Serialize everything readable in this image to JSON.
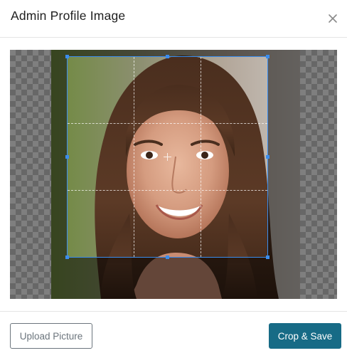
{
  "dialog": {
    "title": "Admin Profile Image",
    "close_icon": "close-icon"
  },
  "cropper": {
    "image": "portrait-photo",
    "grid": "rule-of-thirds"
  },
  "footer": {
    "upload_label": "Upload Picture",
    "save_label": "Crop & Save"
  },
  "colors": {
    "accent": "#3b8ded",
    "primary_button": "#176b86",
    "secondary_border": "#6c757d"
  }
}
